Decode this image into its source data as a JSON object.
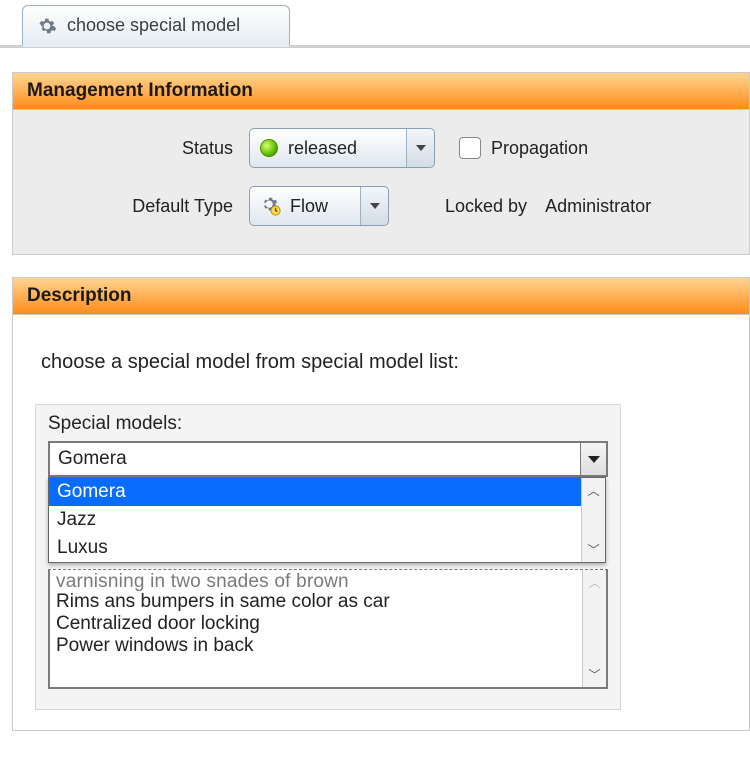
{
  "tab": {
    "label": "choose special model",
    "icon": "gear-icon"
  },
  "management": {
    "header": "Management Information",
    "status_label": "Status",
    "status_value": "released",
    "status_icon": "green-dot-icon",
    "propagation_label": "Propagation",
    "propagation_checked": false,
    "default_type_label": "Default Type",
    "default_type_value": "Flow",
    "default_type_icon": "gear-arrow-icon",
    "locked_by_label": "Locked by",
    "locked_by_value": "Administrator"
  },
  "description": {
    "header": "Description",
    "intro": "choose a special model from special model list:",
    "special_models_label": "Special models:",
    "combo_selected": "Gomera",
    "combo_options": [
      "Gomera",
      "Jazz",
      "Luxus"
    ],
    "features_partial": "varnisning in two snades of brown",
    "features": [
      "Rims ans bumpers in same color as car",
      "Centralized door locking",
      "Power windows in back"
    ]
  },
  "colors": {
    "panel_header_gradient_top": "#ffd591",
    "panel_header_gradient_bottom": "#ff8c1a",
    "selection_blue": "#0a6cff"
  }
}
